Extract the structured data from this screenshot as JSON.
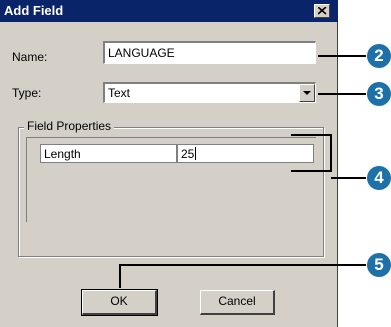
{
  "dialog": {
    "title": "Add Field",
    "name_label": "Name:",
    "name_value": "LANGUAGE",
    "type_label": "Type:",
    "type_value": "Text",
    "group_label": "Field Properties",
    "properties": [
      {
        "name": "Length",
        "value": "25"
      }
    ],
    "ok_label": "OK",
    "cancel_label": "Cancel"
  },
  "callouts": [
    "2",
    "3",
    "4",
    "5"
  ],
  "colors": {
    "title_bar": "#0a246a",
    "dialog_face": "#d4d0c8",
    "callout": "#1d71a8"
  },
  "icons": {
    "close": "close-icon",
    "dropdown": "chevron-down-icon"
  }
}
